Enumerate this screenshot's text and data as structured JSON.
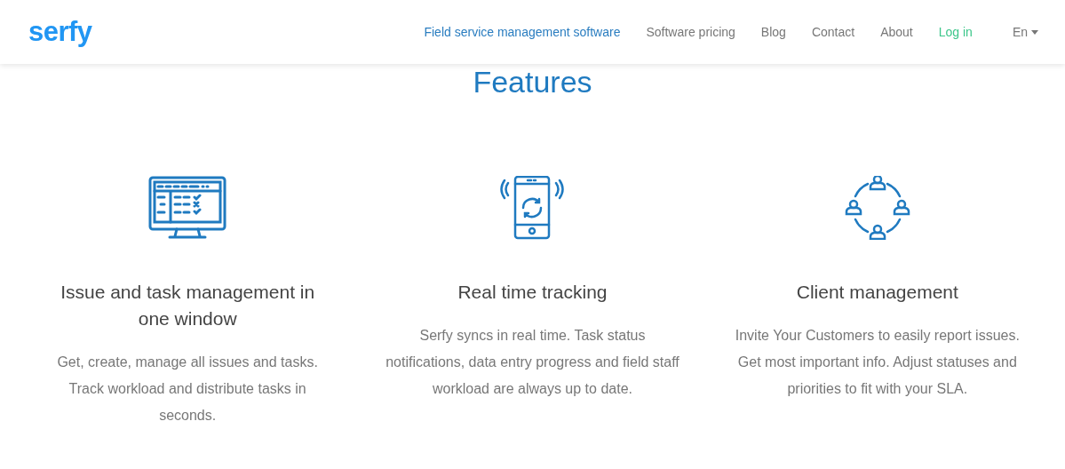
{
  "header": {
    "logo": "serfy",
    "nav": [
      {
        "label": "Field service management software",
        "kind": "link",
        "selected": true
      },
      {
        "label": "Software pricing",
        "kind": "link",
        "selected": false
      },
      {
        "label": "Blog",
        "kind": "link",
        "selected": false
      },
      {
        "label": "Contact",
        "kind": "link",
        "selected": false
      },
      {
        "label": "About",
        "kind": "link",
        "selected": false
      },
      {
        "label": "Log in",
        "kind": "login",
        "selected": false
      }
    ],
    "language": "En"
  },
  "title": "Features",
  "features": [
    {
      "kind": "monitor",
      "heading": "Issue and task management in one window",
      "text": "Get, create, manage all issues and tasks. Track workload and distribute tasks in seconds."
    },
    {
      "kind": "phone",
      "heading": "Real time tracking",
      "text": "Serfy syncs in real time. Task status notifications, data entry progress and field staff workload are always up to date."
    },
    {
      "kind": "people",
      "heading": "Client management",
      "text": "Invite Your Customers to easily report issues. Get most important info. Adjust statuses and priorities to fit with your SLA."
    }
  ]
}
